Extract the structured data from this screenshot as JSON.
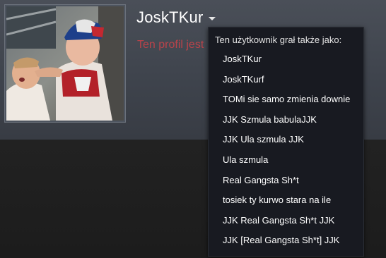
{
  "profile": {
    "username": "JoskTKur",
    "private_notice": "Ten profil jest"
  },
  "dropdown": {
    "title": "Ten użytkownik grał także jako:",
    "aliases": [
      "JoskTKur",
      "JoskTKurf",
      "TOMi sie samo zmienia downie",
      "JJK Szmula babulaJJK",
      "JJK Ula szmula JJK",
      "Ula szmula",
      "Real Gangsta Sh*t",
      "tosiek ty kurwo stara na ile",
      "JJK Real Gangsta Sh*t JJK",
      "JJK [Real Gangsta Sh*t] JJK"
    ]
  },
  "colors": {
    "private_notice": "#b8434a",
    "header_bg": "#43474f",
    "dropdown_bg": "#181a21"
  },
  "icons": {
    "dropdown_caret": "caret-down-icon"
  }
}
